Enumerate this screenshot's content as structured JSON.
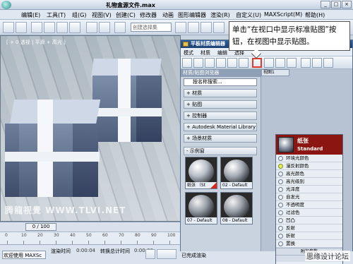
{
  "window": {
    "title": "礼物盒源文件.max",
    "controls": [
      "_",
      "□",
      "×"
    ]
  },
  "menu": {
    "items": [
      "编辑(E)",
      "工具(T)",
      "组(G)",
      "视图(V)",
      "创建(C)",
      "修改器",
      "动画",
      "图形编辑器",
      "渲染(R)",
      "自定义(U)",
      "MAXScript(M)",
      "帮助(H)"
    ]
  },
  "toolbar": {
    "selection_combo": "创建选择集"
  },
  "viewport": {
    "label": "[ + 0 透视 | 平滑 + 高光 ]",
    "watermark": "腾龍視覺 WWW.TLVI.NET"
  },
  "timeline": {
    "frame": "0 / 100",
    "ruler_numbers": [
      "0",
      "10",
      "20",
      "30",
      "40",
      "50",
      "60",
      "70",
      "80",
      "90",
      "100"
    ]
  },
  "status": {
    "welcome": "欢迎使用 MAXSc",
    "render_time_label": "渲染时间",
    "render_time_value": "0:00:04",
    "convert_label": "转换总计时间",
    "convert_value": "0:00:00"
  },
  "material_editor": {
    "title": "平板材质编辑器",
    "menu": [
      "模式",
      "材质",
      "编辑",
      "选择"
    ],
    "browser_header": "材质/贴图浏览器",
    "search_placeholder": "按名称搜索...",
    "categories": [
      "+ 材质",
      "+ 贴图",
      "+ 控制器",
      "+ Autodesk Material Library",
      "+ 场景材质",
      "- 示例窗"
    ],
    "swatches": [
      {
        "name": "纸张 （St",
        "color": "#d9261c"
      },
      {
        "name": "02 - Default",
        "color": ""
      },
      {
        "name": "07 - Default",
        "color": ""
      },
      {
        "name": "08 - Default",
        "color": ""
      }
    ],
    "view_tab": "视图1",
    "node": {
      "name": "纸张",
      "type": "Standard",
      "slots": [
        "环境光颜色",
        "漫反射颜色",
        "高光颜色",
        "高光级别",
        "光泽度",
        "自发光",
        "不透明度",
        "过滤色",
        "凹凸",
        "反射",
        "折射",
        "置换"
      ],
      "active_slot": 1,
      "footer1": "附加参数",
      "footer2": "暗箱"
    },
    "status": "已完成渲染"
  },
  "callout": {
    "text": "单击“在视口中显示标准贴图”按钮，在视图中显示贴图。"
  },
  "site_watermark": "思缘设计论坛",
  "colors": {
    "title_bar": "#2f5f9c",
    "node_header": "#8b1510",
    "highlight": "#e23a2a"
  }
}
